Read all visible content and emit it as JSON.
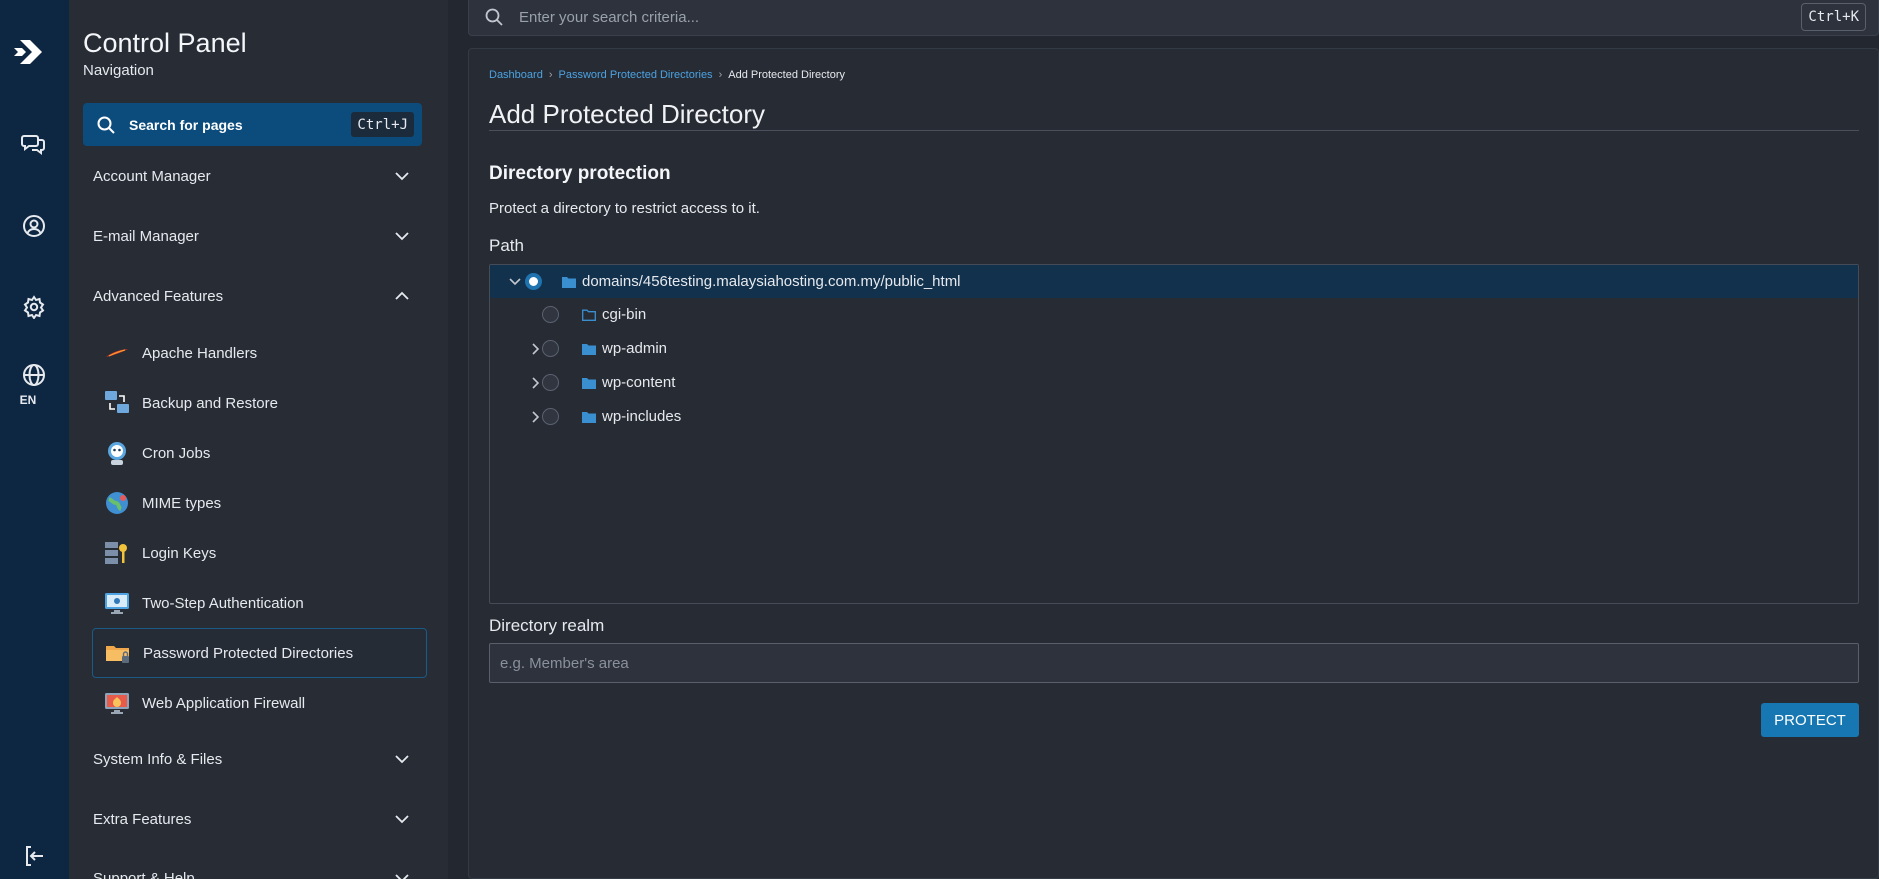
{
  "rail": {
    "lang": "EN"
  },
  "sidebar": {
    "title": "Control Panel",
    "subtitle": "Navigation",
    "search_label": "Search for pages",
    "search_shortcut": "Ctrl+J",
    "sections": [
      {
        "label": "Account Manager"
      },
      {
        "label": "E-mail Manager"
      },
      {
        "label": "Advanced Features"
      },
      {
        "label": "System Info & Files"
      },
      {
        "label": "Extra Features"
      },
      {
        "label": "Support & Help"
      }
    ],
    "advanced_items": [
      {
        "label": "Apache Handlers",
        "icon": "apache-feather-icon"
      },
      {
        "label": "Backup and Restore",
        "icon": "backup-computers-icon"
      },
      {
        "label": "Cron Jobs",
        "icon": "cron-robot-icon"
      },
      {
        "label": "MIME types",
        "icon": "mime-globe-icon"
      },
      {
        "label": "Login Keys",
        "icon": "key-server-icon"
      },
      {
        "label": "Two-Step Authentication",
        "icon": "two-step-monitor-icon"
      },
      {
        "label": "Password Protected Directories",
        "icon": "locked-folder-icon"
      },
      {
        "label": "Web Application Firewall",
        "icon": "firewall-monitor-icon"
      }
    ]
  },
  "top_search": {
    "placeholder": "Enter your search criteria...",
    "shortcut": "Ctrl+K"
  },
  "breadcrumb": {
    "items": [
      "Dashboard",
      "Password Protected Directories",
      "Add Protected Directory"
    ]
  },
  "page": {
    "title": "Add Protected Directory",
    "section_title": "Directory protection",
    "section_desc": "Protect a directory to restrict access to it.",
    "path_label": "Path",
    "realm_label": "Directory realm",
    "realm_placeholder": "e.g. Member's area",
    "protect_button": "PROTECT"
  },
  "tree": {
    "root": "domains/456testing.malaysiahosting.com.my/public_html",
    "children": [
      "cgi-bin",
      "wp-admin",
      "wp-content",
      "wp-includes"
    ]
  },
  "colors": {
    "rail_bg": "#0d2742",
    "sidebar_bg": "#272c35",
    "accent": "#1677b3",
    "link": "#4ba3e3",
    "selected_row": "#12314c"
  }
}
